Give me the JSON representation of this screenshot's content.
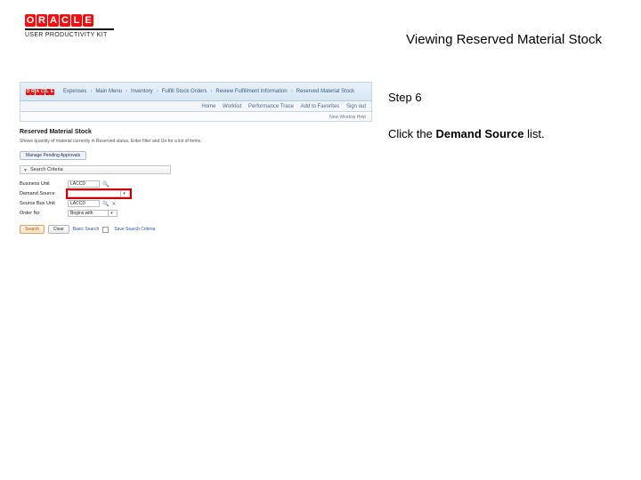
{
  "header": {
    "logo_letters": [
      "O",
      "R",
      "A",
      "C",
      "L",
      "E"
    ],
    "upk_line": "USER PRODUCTIVITY KIT",
    "page_title": "Viewing Reserved Material Stock"
  },
  "instruction": {
    "step_label": "Step 6",
    "prefix": "Click the ",
    "bold": "Demand Source",
    "suffix": " list."
  },
  "app": {
    "breadcrumb": [
      "Expenses",
      "Main Menu",
      "Inventory",
      "Fulfill Stock Orders",
      "Review Fulfillment Information",
      "Reserved Material Stock"
    ],
    "sublinks": [
      "Home",
      "Worklist",
      "Performance Trace",
      "Add to Favorites",
      "Sign out"
    ],
    "status_line": "New Window  Help",
    "section_title": "Reserved Material Stock",
    "section_desc": "Shows quantity of material currently in Reserved status. Enter filter and Go for a list of items.",
    "band_button": "Manage Pending Approvals",
    "accordion_label": "Search Criteria",
    "form": {
      "rows": [
        {
          "label": "Business Unit",
          "value": "LACCD"
        },
        {
          "label": "Demand Source",
          "value": ""
        },
        {
          "label": "Source Bus Unit",
          "value": "LACCD"
        },
        {
          "label": "Order No",
          "value": "Begins with"
        }
      ]
    },
    "actions": {
      "search": "Search",
      "clear": "Clear",
      "basic": "Basic Search",
      "save": "Save Search Criteria"
    }
  }
}
